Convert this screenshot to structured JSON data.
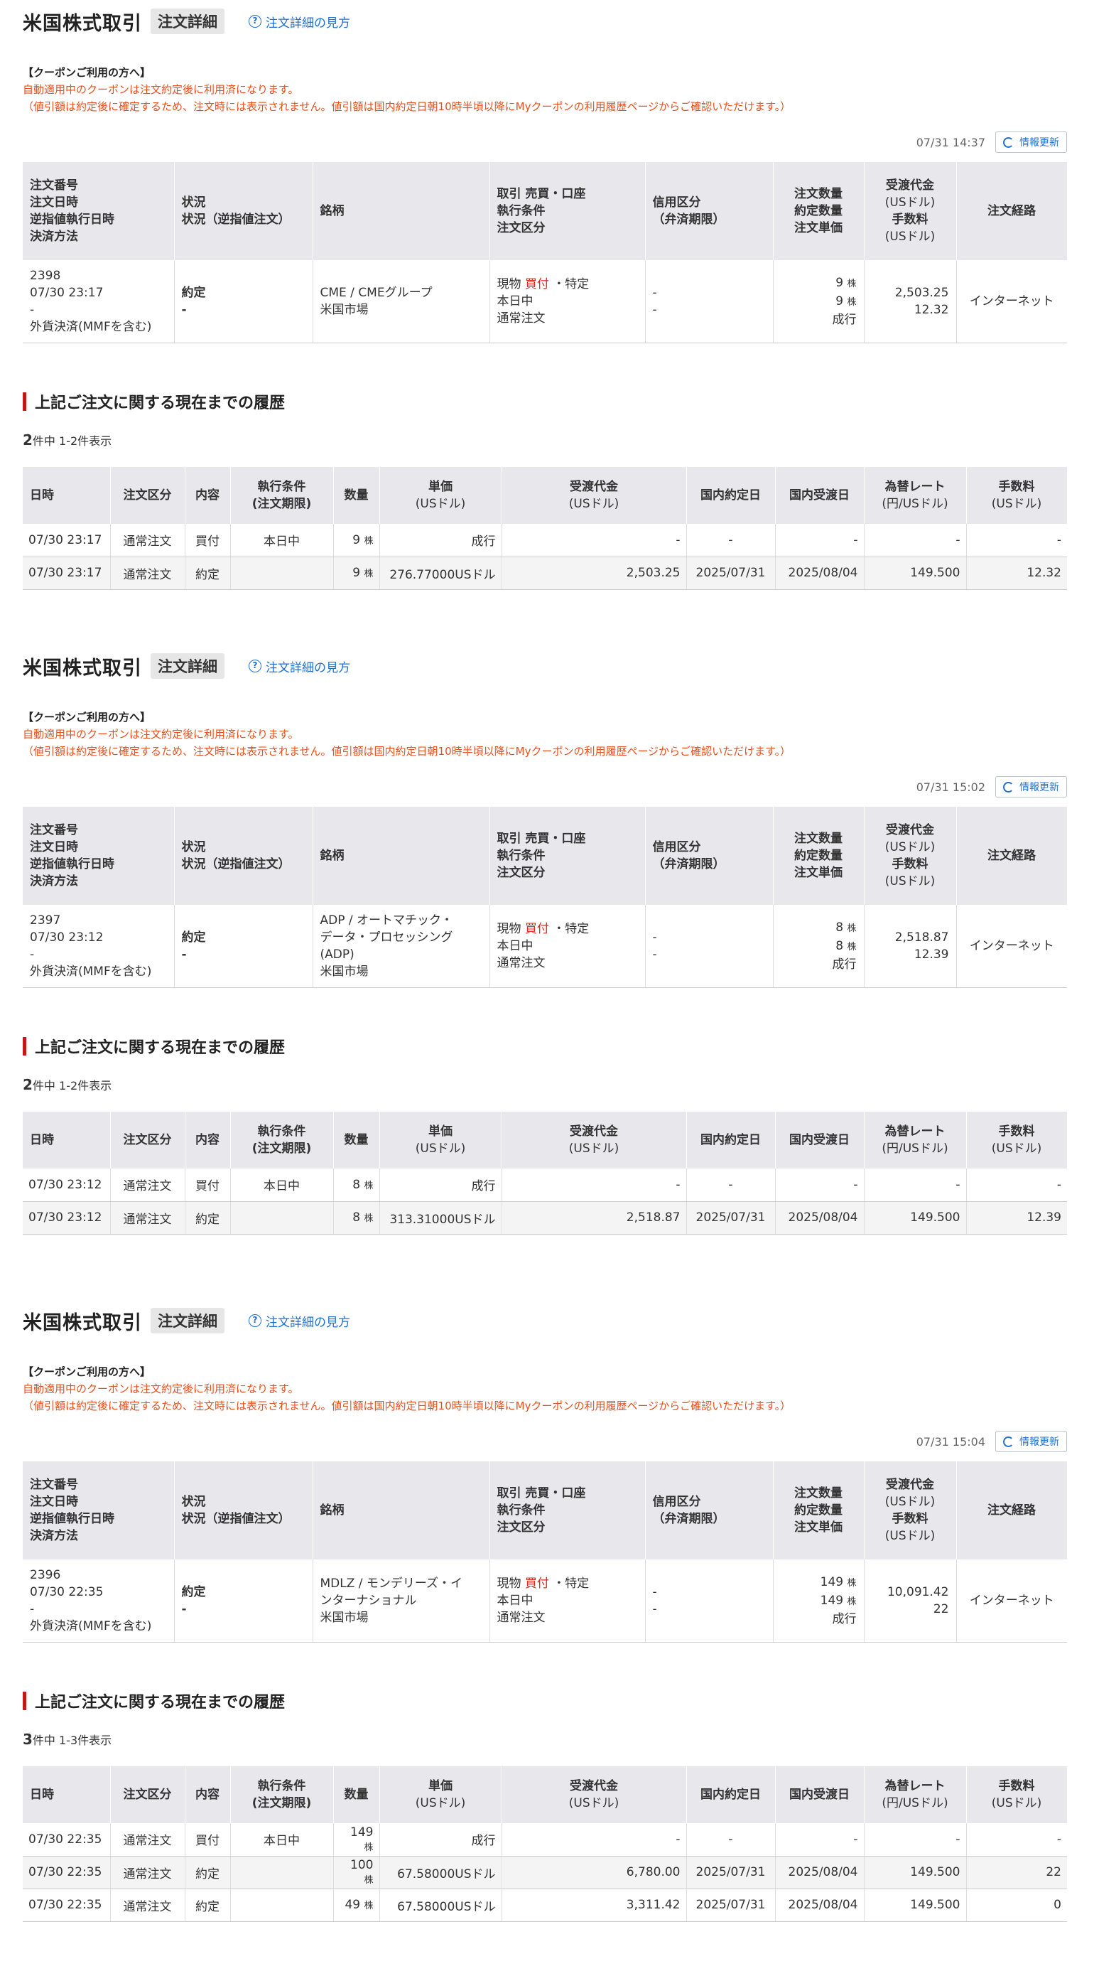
{
  "common": {
    "page_title": "米国株式取引",
    "badge": "注文詳細",
    "help_link": "注文詳細の見方",
    "help_icon": "question-circle-icon",
    "coupon_head": "【クーポンご利用の方へ】",
    "coupon_line1": "自動適用中のクーポンは注文約定後に利用済になります。",
    "coupon_line2": "（値引額は約定後に確定するため、注文時には表示されません。値引額は国内約定日朝10時半頃以降にMyクーポンの利用履歴ページからご確認いただけます。）",
    "refresh_label": "情報更新",
    "refresh_icon": "refresh-icon",
    "order_headers": {
      "col1": [
        "注文番号",
        "注文日時",
        "逆指値執行日時",
        "決済方法"
      ],
      "col2": [
        "状況",
        "状況（逆指値注文）"
      ],
      "col3": "銘柄",
      "col4": [
        "取引 売買・口座",
        "執行条件",
        "注文区分"
      ],
      "col5": [
        "信用区分",
        "（弁済期限）"
      ],
      "col6": [
        "注文数量",
        "約定数量",
        "注文単価"
      ],
      "col7": [
        "受渡代金",
        "(USドル)",
        "手数料",
        "(USドル)"
      ],
      "col8": "注文経路"
    },
    "history_title": "上記ご注文に関する現在までの履歴",
    "history_headers": {
      "date": "日時",
      "kind": "注文区分",
      "content": "内容",
      "cond": [
        "執行条件",
        "(注文期限)"
      ],
      "qty": "数量",
      "price": [
        "単価",
        "(USドル)"
      ],
      "amount": [
        "受渡代金",
        "(USドル)"
      ],
      "exec_date": "国内約定日",
      "settle_date": "国内受渡日",
      "rate": [
        "為替レート",
        "(円/USドル)"
      ],
      "fee": [
        "手数料",
        "(USドル)"
      ]
    },
    "accent_color": "#e2231a",
    "link_color": "#1f6fd0",
    "notice_color": "#e8501e"
  },
  "orders": [
    {
      "timestamp": "07/31 14:37",
      "order_no": "2398",
      "order_time": "07/30 23:17",
      "stop_time": "-",
      "settlement": "外貨決済(MMFを含む)",
      "status": "約定",
      "status_stop": "-",
      "stock_lines": [
        "CME / CMEグループ",
        "米国市場"
      ],
      "trade_kind": "現物",
      "trade_side": "買付",
      "account": "・特定",
      "exec_cond": "本日中",
      "order_type": "通常注文",
      "credit": "-",
      "credit_due": "-",
      "order_qty": "9",
      "filled_qty": "9",
      "unit": "株",
      "order_price": "成行",
      "delivery": "2,503.25",
      "fee": "12.32",
      "route": "インターネット",
      "count_total": "2",
      "count_suffix": "件中 1-2件表示",
      "history": [
        {
          "date": "07/30 23:17",
          "kind": "通常注文",
          "content": "買付",
          "cond": "本日中",
          "qty": "9",
          "price": "成行",
          "amount": "-",
          "exec_date": "-",
          "settle_date": "-",
          "rate": "-",
          "fee": "-"
        },
        {
          "date": "07/30 23:17",
          "kind": "通常注文",
          "content": "約定",
          "cond": "",
          "qty": "9",
          "price": "276.77000USドル",
          "amount": "2,503.25",
          "exec_date": "2025/07/31",
          "settle_date": "2025/08/04",
          "rate": "149.500",
          "fee": "12.32"
        }
      ]
    },
    {
      "timestamp": "07/31 15:02",
      "order_no": "2397",
      "order_time": "07/30 23:12",
      "stop_time": "-",
      "settlement": "外貨決済(MMFを含む)",
      "status": "約定",
      "status_stop": "-",
      "stock_lines": [
        "ADP / オートマチック・",
        "データ・プロセッシング",
        "(ADP)",
        "米国市場"
      ],
      "trade_kind": "現物",
      "trade_side": "買付",
      "account": "・特定",
      "exec_cond": "本日中",
      "order_type": "通常注文",
      "credit": "-",
      "credit_due": "-",
      "order_qty": "8",
      "filled_qty": "8",
      "unit": "株",
      "order_price": "成行",
      "delivery": "2,518.87",
      "fee": "12.39",
      "route": "インターネット",
      "count_total": "2",
      "count_suffix": "件中 1-2件表示",
      "history": [
        {
          "date": "07/30 23:12",
          "kind": "通常注文",
          "content": "買付",
          "cond": "本日中",
          "qty": "8",
          "price": "成行",
          "amount": "-",
          "exec_date": "-",
          "settle_date": "-",
          "rate": "-",
          "fee": "-"
        },
        {
          "date": "07/30 23:12",
          "kind": "通常注文",
          "content": "約定",
          "cond": "",
          "qty": "8",
          "price": "313.31000USドル",
          "amount": "2,518.87",
          "exec_date": "2025/07/31",
          "settle_date": "2025/08/04",
          "rate": "149.500",
          "fee": "12.39"
        }
      ]
    },
    {
      "timestamp": "07/31 15:04",
      "order_no": "2396",
      "order_time": "07/30 22:35",
      "stop_time": "-",
      "settlement": "外貨決済(MMFを含む)",
      "status": "約定",
      "status_stop": "-",
      "stock_lines": [
        "MDLZ / モンデリーズ・イ",
        "ンターナショナル",
        "米国市場"
      ],
      "trade_kind": "現物",
      "trade_side": "買付",
      "account": "・特定",
      "exec_cond": "本日中",
      "order_type": "通常注文",
      "credit": "-",
      "credit_due": "-",
      "order_qty": "149",
      "filled_qty": "149",
      "unit": "株",
      "order_price": "成行",
      "delivery": "10,091.42",
      "fee": "22",
      "route": "インターネット",
      "count_total": "3",
      "count_suffix": "件中 1-3件表示",
      "history": [
        {
          "date": "07/30 22:35",
          "kind": "通常注文",
          "content": "買付",
          "cond": "本日中",
          "qty": "149",
          "price": "成行",
          "amount": "-",
          "exec_date": "-",
          "settle_date": "-",
          "rate": "-",
          "fee": "-"
        },
        {
          "date": "07/30 22:35",
          "kind": "通常注文",
          "content": "約定",
          "cond": "",
          "qty": "100",
          "price": "67.58000USドル",
          "amount": "6,780.00",
          "exec_date": "2025/07/31",
          "settle_date": "2025/08/04",
          "rate": "149.500",
          "fee": "22"
        },
        {
          "date": "07/30 22:35",
          "kind": "通常注文",
          "content": "約定",
          "cond": "",
          "qty": "49",
          "price": "67.58000USドル",
          "amount": "3,311.42",
          "exec_date": "2025/07/31",
          "settle_date": "2025/08/04",
          "rate": "149.500",
          "fee": "0"
        }
      ]
    }
  ]
}
